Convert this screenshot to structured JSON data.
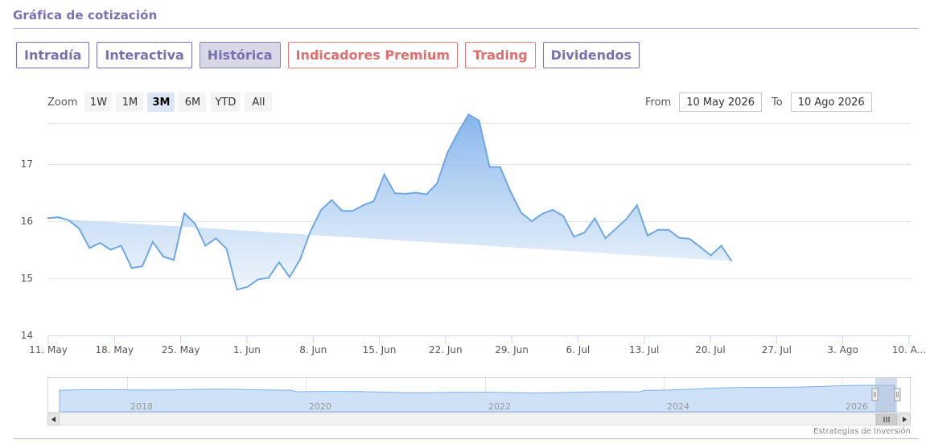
{
  "section_title": "Gráfica de cotización",
  "tabs": [
    {
      "label": "Intradía"
    },
    {
      "label": "Interactiva"
    },
    {
      "label": "Histórica"
    },
    {
      "label": "Indicadores Premium"
    },
    {
      "label": "Trading"
    },
    {
      "label": "Dividendos"
    }
  ],
  "zoom": {
    "label": "Zoom",
    "buttons": [
      "1W",
      "1M",
      "3M",
      "6M",
      "YTD",
      "All"
    ],
    "selected": "3M"
  },
  "range": {
    "from_label": "From",
    "from_value": "10 May 2026",
    "to_label": "To",
    "to_value": "10 Ago 2026"
  },
  "chart_data": {
    "type": "area",
    "ylim": [
      14,
      18
    ],
    "yticks": [
      "14",
      "15",
      "16",
      "17"
    ],
    "xlabels": [
      "11. May",
      "18. May",
      "25. May",
      "1. Jun",
      "8. Jun",
      "15. Jun",
      "22. Jun",
      "29. Jun",
      "6. Jul",
      "13. Jul",
      "20. Jul",
      "27. Jul",
      "3. Ago",
      "10. A..."
    ],
    "x": [
      0,
      2,
      4,
      6,
      8,
      10,
      12,
      14,
      16,
      18,
      20,
      22,
      24,
      26,
      28,
      30,
      32,
      34,
      36,
      38,
      40,
      42,
      44,
      46,
      48,
      50,
      52,
      54,
      56,
      58,
      60,
      62,
      64,
      66,
      68,
      70,
      72,
      74,
      76,
      78,
      80,
      82,
      84,
      86,
      88,
      90,
      92,
      94,
      96,
      98,
      100,
      102,
      104,
      106,
      108,
      110,
      112,
      114,
      116,
      118,
      120,
      122,
      124,
      126,
      128,
      130,
      132,
      134,
      136,
      138,
      140,
      142,
      144,
      146,
      148,
      150,
      152,
      154,
      156,
      158,
      160,
      162,
      164
    ],
    "values": [
      16.05,
      16.07,
      16.02,
      15.87,
      15.53,
      15.62,
      15.5,
      15.57,
      15.18,
      15.21,
      15.64,
      15.38,
      15.32,
      16.14,
      15.96,
      15.57,
      15.7,
      15.52,
      14.8,
      14.85,
      14.98,
      15.01,
      15.28,
      15.02,
      15.33,
      15.83,
      16.2,
      16.37,
      16.18,
      16.18,
      16.28,
      16.35,
      16.82,
      16.49,
      16.48,
      16.5,
      16.47,
      16.66,
      17.2,
      17.55,
      17.87,
      17.76,
      16.95,
      16.95,
      16.51,
      16.15,
      16.0,
      16.13,
      16.2,
      16.09,
      15.73,
      15.8,
      16.05,
      15.7,
      15.87,
      16.04,
      16.28,
      15.75,
      15.85,
      15.85,
      15.71,
      15.69,
      15.55,
      15.4,
      15.57,
      15.3
    ],
    "nav_labels": [
      "2018",
      "2020",
      "2022",
      "2024",
      "2026"
    ]
  },
  "credit": "Estrategias de Inversión",
  "colors": {
    "line": "#6fa7e6",
    "fill_top": "#7fb1ea",
    "fill_bottom": "#e8f1fb",
    "accent": "#7a6fb0",
    "premium": "#e06e6e"
  }
}
